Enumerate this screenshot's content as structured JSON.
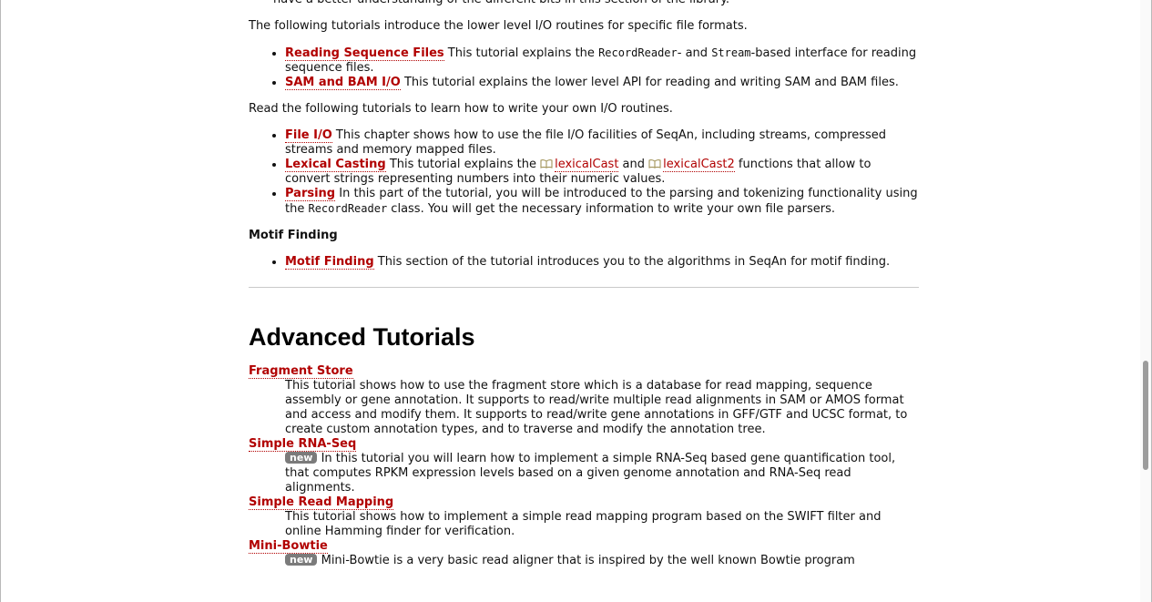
{
  "intro_cut": "have a better understanding of the different bits in this section of the library.",
  "low_level_intro": "The following tutorials introduce the lower level I/O routines for specific file formats.",
  "low_level_items": [
    {
      "link": "Reading Sequence Files",
      "t1": " This tutorial explains the ",
      "c1": "RecordReader",
      "t2": "- and ",
      "c2": "Stream",
      "t3": "-based interface for reading sequence files."
    },
    {
      "link": "SAM and BAM I/O",
      "text": " This tutorial explains the lower level API for reading and writing SAM and BAM files."
    }
  ],
  "own_io_intro": "Read the following tutorials to learn how to write your own I/O routines.",
  "own_io_items": [
    {
      "link": "File I/O",
      "text": " This chapter shows how to use the file I/O facilities of SeqAn, including streams, compressed streams and memory mapped files."
    },
    {
      "link": "Lexical Casting",
      "t1": " This tutorial explains the ",
      "api1": "lexicalCast",
      "t2": " and ",
      "api2": "lexicalCast2",
      "t3": " functions that allow to convert strings representing numbers into their numeric values."
    },
    {
      "link": "Parsing",
      "t1": " In this part of the tutorial, you will be introduced to the parsing and tokenizing functionality using the ",
      "c1": "RecordReader",
      "t2": " class. You will get the necessary information to write your own file parsers."
    }
  ],
  "motif": {
    "heading": "Motif Finding",
    "items": [
      {
        "link": "Motif Finding",
        "text": " This section of the tutorial introduces you to the algorithms in SeqAn for motif finding."
      }
    ]
  },
  "advanced": {
    "title": "Advanced Tutorials",
    "badge_label": "new",
    "items": [
      {
        "term": "Fragment Store",
        "desc": "This tutorial shows how to use the fragment store which is a database for read mapping, sequence assembly or gene annotation. It supports to read/write multiple read alignments in SAM or AMOS format and access and modify them. It supports to read/write gene annotations in GFF/GTF and UCSC format, to create custom annotation types, and to traverse and modify the annotation tree."
      },
      {
        "term": "Simple RNA-Seq",
        "desc": " In this tutorial you will learn how to implement a simple RNA-Seq based gene quantification tool, that computes RPKM expression levels based on a given genome annotation and RNA-Seq read alignments."
      },
      {
        "term": "Simple Read Mapping",
        "desc": "This tutorial shows how to implement a simple read mapping program based on the SWIFT filter and online Hamming finder for verification."
      },
      {
        "term": "Mini-Bowtie",
        "desc": " Mini-Bowtie is a very basic read aligner that is inspired by the well known Bowtie program"
      }
    ]
  },
  "colors": {
    "link": "#b10000",
    "badge": "#7b7b7b"
  }
}
